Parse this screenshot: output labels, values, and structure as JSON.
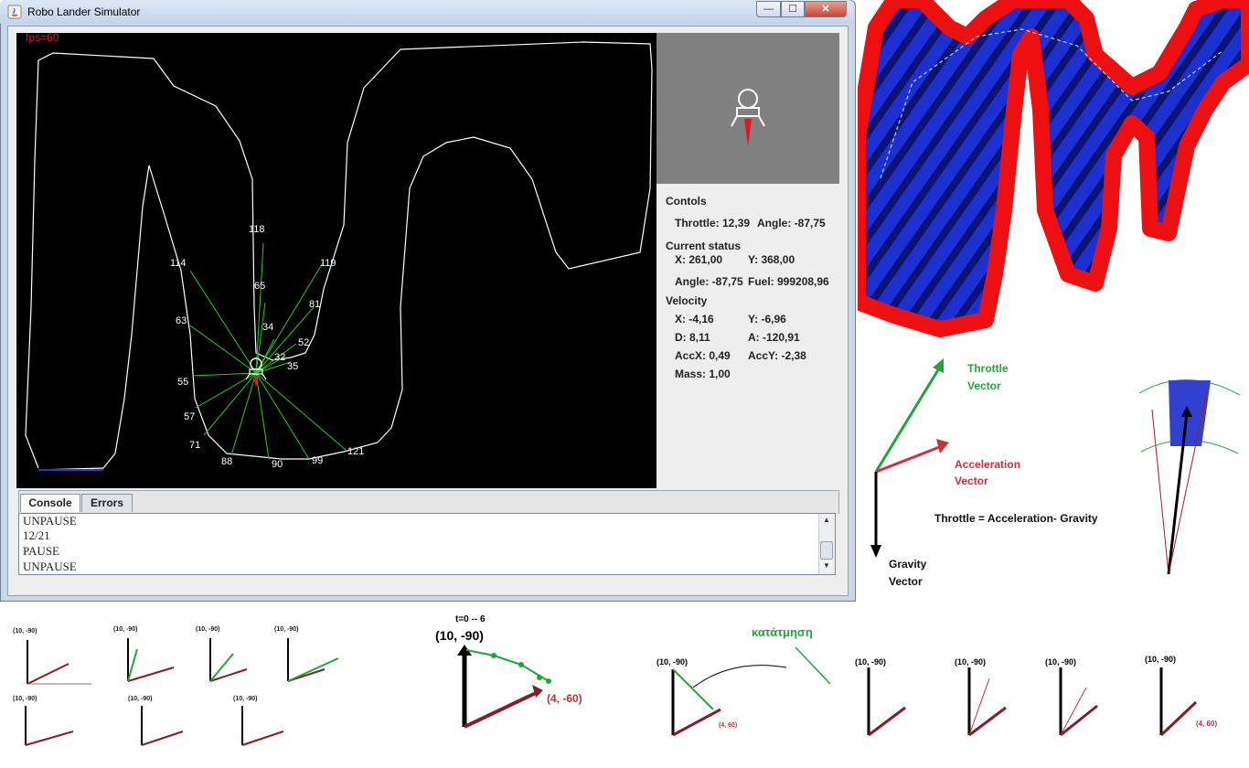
{
  "window": {
    "title": "Robo Lander Simulator",
    "min_icon": "minimize-icon",
    "max_icon": "maximize-icon",
    "close_icon": "close-icon",
    "close_glyph": "✕"
  },
  "simulator": {
    "fps": "fps=60",
    "sensor_labels": [
      "118",
      "114",
      "119",
      "65",
      "81",
      "63",
      "34",
      "52",
      "32",
      "35",
      "55",
      "57",
      "71",
      "88",
      "90",
      "99",
      "121"
    ]
  },
  "controls": {
    "section": "Contols",
    "throttle": "Throttle: 12,39",
    "angle": "Angle: -87,75"
  },
  "status": {
    "section": "Current status",
    "x": "X: 261,00",
    "y": "Y: 368,00",
    "angle": "Angle: -87,75",
    "fuel": "Fuel: 999208,96"
  },
  "velocity": {
    "section": "Velocity",
    "x": "X: -4,16",
    "y": "Y: -6,96",
    "d": "D: 8,11",
    "a": "A: -120,91",
    "accx": "AccX: 0,49",
    "accy": "AccY: -2,38",
    "mass": "Mass: 1,00"
  },
  "tabs": [
    "Console",
    "Errors"
  ],
  "console_lines": [
    "UNPAUSE",
    "12/21",
    "PAUSE",
    "UNPAUSE"
  ],
  "vector_diagram": {
    "throttle": [
      "Throttle",
      "Vector"
    ],
    "acceleration": [
      "Acceleration",
      "Vector"
    ],
    "gravity": [
      "Gravity",
      "Vector"
    ],
    "equation": "Throttle = Acceleration- Gravity"
  },
  "sketches": {
    "t_label": "t=0 -- 6",
    "big_vec1": "(10, -90)",
    "big_vec2": "(4, -60)",
    "segmentation": "κατάτμηση",
    "small_vec1": "(10, -90)",
    "small_vec2": "(4, 60)"
  },
  "colors": {
    "throttle": "#22a43c",
    "acceleration": "#d0303a",
    "wall_red": "#ee1010",
    "terrain_blue": "#1c2fd0"
  }
}
